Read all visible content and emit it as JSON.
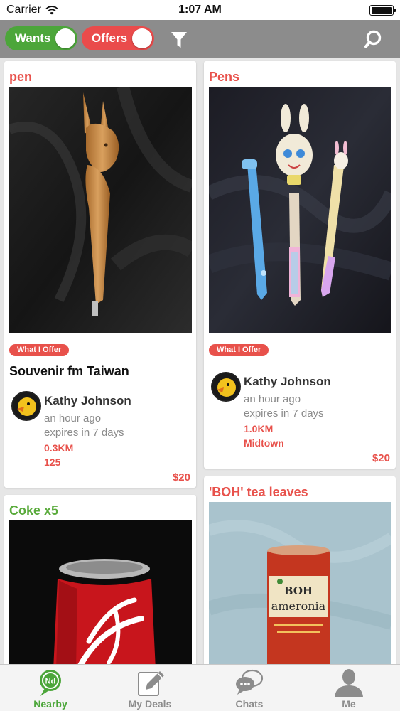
{
  "status_bar": {
    "carrier": "Carrier",
    "time": "1:07 AM"
  },
  "toolbar": {
    "wants_label": "Wants",
    "offers_label": "Offers",
    "wants_color": "#4ca63a",
    "offers_color": "#ea4b4b",
    "filter_icon": "filter-icon",
    "search_icon": "search-icon"
  },
  "cards": [
    {
      "title": "pen",
      "badge": "What I Offer",
      "subtitle": "Souvenir fm Taiwan",
      "user": "Kathy Johnson",
      "time": "an hour ago",
      "expires": "expires in 7 days",
      "distance": "0.3KM",
      "location": "125",
      "price": "$20"
    },
    {
      "title": "Pens",
      "badge": "What I Offer",
      "user": "Kathy Johnson",
      "time": "an hour ago",
      "expires": "expires in 7 days",
      "distance": "1.0KM",
      "location": "Midtown",
      "price": "$20"
    },
    {
      "title": "Coke x5"
    },
    {
      "title": "'BOH' tea leaves",
      "can_text_1": "BOH",
      "can_text_2": "ameronia"
    }
  ],
  "tabs": [
    {
      "label": "Nearby",
      "icon_text": "Nd",
      "active": true
    },
    {
      "label": "My Deals"
    },
    {
      "label": "Chats"
    },
    {
      "label": "Me"
    }
  ],
  "colors": {
    "offer": "#e8514b",
    "want": "#5aab3c",
    "toolbar": "#8c8c8c"
  }
}
